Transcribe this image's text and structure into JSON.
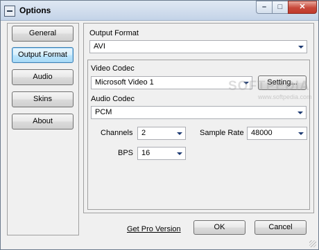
{
  "window": {
    "title": "Options",
    "icons": {
      "system": "window-menu-icon",
      "minimize": "minimize-icon",
      "maximize": "maximize-icon",
      "close": "close-icon"
    },
    "glyphs": {
      "minimize": "–",
      "maximize": "□",
      "close": "✕"
    }
  },
  "sidebar": {
    "items": [
      {
        "label": "General",
        "active": false
      },
      {
        "label": "Output Format",
        "active": true
      },
      {
        "label": "Audio",
        "active": false
      },
      {
        "label": "Skins",
        "active": false
      },
      {
        "label": "About",
        "active": false
      }
    ]
  },
  "output_format": {
    "label": "Output Format",
    "value": "AVI"
  },
  "video_codec": {
    "label": "Video Codec",
    "value": "Microsoft Video 1",
    "settings_button": "Setting..."
  },
  "audio_codec": {
    "label": "Audio Codec",
    "value": "PCM"
  },
  "channels": {
    "label": "Channels",
    "value": "2"
  },
  "sample_rate": {
    "label": "Sample Rate",
    "value": "48000"
  },
  "bps": {
    "label": "BPS",
    "value": "16"
  },
  "footer": {
    "pro_link": "Get Pro Version",
    "ok": "OK",
    "cancel": "Cancel"
  },
  "watermark": {
    "brand": "SOFTPEDIA",
    "url": "www.softpedia.com"
  },
  "colors": {
    "active_button": "#bee6fd",
    "close_button": "#c7483a",
    "dropdown_arrow": "#1d3a72"
  }
}
